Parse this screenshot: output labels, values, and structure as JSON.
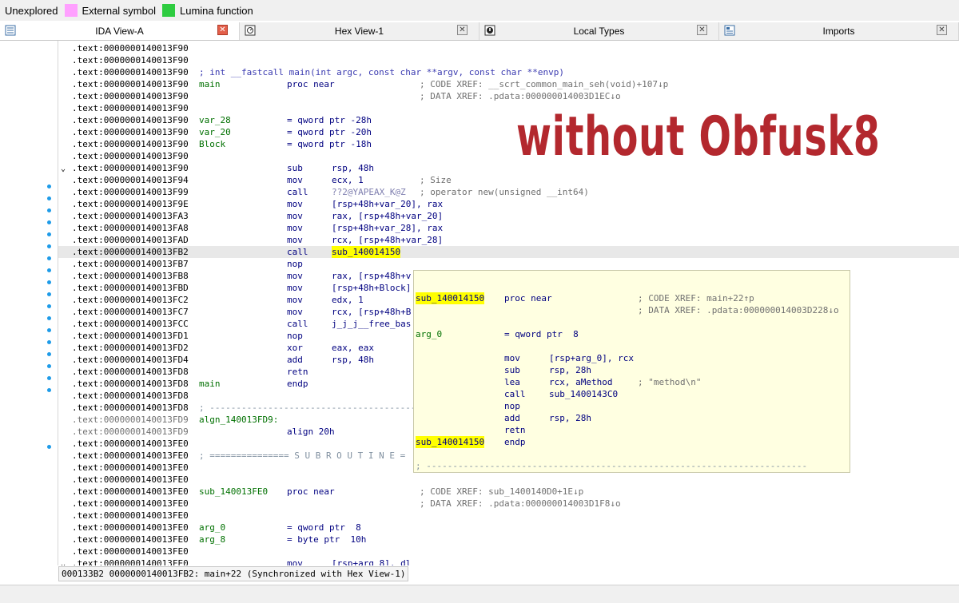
{
  "legend": {
    "items": [
      {
        "label": "Unexplored",
        "color": ""
      },
      {
        "label": "External symbol",
        "color": "#ffa0ff"
      },
      {
        "label": "Lumina function",
        "color": "#2ecc40"
      }
    ]
  },
  "tabs": [
    {
      "label": "IDA View-A",
      "icon": "ida-view-icon",
      "close": "✕"
    },
    {
      "label": "Hex View-1",
      "icon": "hex-view-icon",
      "close": "✕"
    },
    {
      "label": "Local Types",
      "icon": "local-types-icon",
      "close": "✕"
    },
    {
      "label": "Imports",
      "icon": "imports-icon",
      "close": "✕"
    }
  ],
  "watermark": "without Obfusk8",
  "lines": [
    {
      "a": ".text:0000000140013F90"
    },
    {
      "a": ".text:0000000140013F90"
    },
    {
      "a": ".text:0000000140013F90",
      "cm": "; int __fastcall main(int argc, const char **argv, const char **envp)"
    },
    {
      "a": ".text:0000000140013F90",
      "lbl": "main",
      "mn": "proc near",
      "xr": "; CODE XREF: __scrt_common_main_seh(void)+107↓p"
    },
    {
      "a": ".text:0000000140013F90",
      "xr": "; DATA XREF: .pdata:000000014003D1EC↓o"
    },
    {
      "a": ".text:0000000140013F90"
    },
    {
      "a": ".text:0000000140013F90",
      "lbl": "var_28",
      "mn": "= qword ptr -28h"
    },
    {
      "a": ".text:0000000140013F90",
      "lbl": "var_20",
      "mn": "= qword ptr -20h"
    },
    {
      "a": ".text:0000000140013F90",
      "lbl": "Block",
      "mn": "= qword ptr -18h"
    },
    {
      "a": ".text:0000000140013F90"
    },
    {
      "a": ".text:0000000140013F90",
      "mn": "sub",
      "op": "rsp, 48h",
      "chev": true
    },
    {
      "a": ".text:0000000140013F94",
      "mn": "mov",
      "op": "ecx, 1",
      "xr": "; Size"
    },
    {
      "a": ".text:0000000140013F99",
      "mn": "call",
      "sym": "??2@YAPEAX_K@Z",
      "xr": "; operator new(unsigned __int64)"
    },
    {
      "a": ".text:0000000140013F9E",
      "mn": "mov",
      "op": "[rsp+48h+var_20], rax"
    },
    {
      "a": ".text:0000000140013FA3",
      "mn": "mov",
      "op": "rax, [rsp+48h+var_20]"
    },
    {
      "a": ".text:0000000140013FA8",
      "mn": "mov",
      "op": "[rsp+48h+var_28], rax"
    },
    {
      "a": ".text:0000000140013FAD",
      "mn": "mov",
      "op": "rcx, [rsp+48h+var_28]"
    },
    {
      "a": ".text:0000000140013FB2",
      "mn": "call",
      "yel": "sub_140014150",
      "hl": true
    },
    {
      "a": ".text:0000000140013FB7",
      "mn": "nop"
    },
    {
      "a": ".text:0000000140013FB8",
      "mn": "mov",
      "op": "rax, [rsp+48h+v"
    },
    {
      "a": ".text:0000000140013FBD",
      "mn": "mov",
      "op": "[rsp+48h+Block]"
    },
    {
      "a": ".text:0000000140013FC2",
      "mn": "mov",
      "op": "edx, 1"
    },
    {
      "a": ".text:0000000140013FC7",
      "mn": "mov",
      "op": "rcx, [rsp+48h+B"
    },
    {
      "a": ".text:0000000140013FCC",
      "mn": "call",
      "op": "j_j_j__free_bas"
    },
    {
      "a": ".text:0000000140013FD1",
      "mn": "nop"
    },
    {
      "a": ".text:0000000140013FD2",
      "mn": "xor",
      "op": "eax, eax"
    },
    {
      "a": ".text:0000000140013FD4",
      "mn": "add",
      "op": "rsp, 48h"
    },
    {
      "a": ".text:0000000140013FD8",
      "mn": "retn"
    },
    {
      "a": ".text:0000000140013FD8",
      "lbl": "main",
      "mn": "endp"
    },
    {
      "a": ".text:0000000140013FD8"
    },
    {
      "a": ".text:0000000140013FD8",
      "sep": "; ---------------------------------------"
    },
    {
      "a": ".text:0000000140013FD9",
      "lbl": "algn_140013FD9:",
      "gray": true
    },
    {
      "a": ".text:0000000140013FD9",
      "mn": "align 20h",
      "gray": true
    },
    {
      "a": ".text:0000000140013FE0"
    },
    {
      "a": ".text:0000000140013FE0",
      "sep": "; =============== S U B R O U T I N E ="
    },
    {
      "a": ".text:0000000140013FE0"
    },
    {
      "a": ".text:0000000140013FE0"
    },
    {
      "a": ".text:0000000140013FE0",
      "lbl": "sub_140013FE0",
      "mn": "proc near",
      "xr": "; CODE XREF: sub_1400140D0+1E↓p"
    },
    {
      "a": ".text:0000000140013FE0",
      "xr": "; DATA XREF: .pdata:000000014003D1F8↓o"
    },
    {
      "a": ".text:0000000140013FE0"
    },
    {
      "a": ".text:0000000140013FE0",
      "lbl": "arg_0",
      "mn": "= qword ptr  8"
    },
    {
      "a": ".text:0000000140013FE0",
      "lbl": "arg_8",
      "mn": "= byte ptr  10h"
    },
    {
      "a": ".text:0000000140013FE0"
    },
    {
      "a": ".text:0000000140013FE0",
      "mn": "mov",
      "op": "[rsp+arg_8], dl",
      "chev": true
    }
  ],
  "popup": {
    "lines": [
      {
        "row": 2,
        "yel": "sub_140014150",
        "mn": "proc near",
        "xr": "; CODE XREF: main+22↑p"
      },
      {
        "row": 3,
        "xr": "; DATA XREF: .pdata:000000014003D228↓o"
      },
      {
        "row": 5,
        "lbl": "arg_0",
        "mn": "= qword ptr  8"
      },
      {
        "row": 7,
        "mn": "mov",
        "op": "[rsp+arg_0], rcx"
      },
      {
        "row": 8,
        "mn": "sub",
        "op": "rsp, 28h"
      },
      {
        "row": 9,
        "mn": "lea",
        "op": "rcx, aMethod",
        "xr": "; \"method\\n\""
      },
      {
        "row": 10,
        "mn": "call",
        "op": "sub_1400143C0"
      },
      {
        "row": 11,
        "mn": "nop"
      },
      {
        "row": 12,
        "mn": "add",
        "op": "rsp, 28h"
      },
      {
        "row": 13,
        "mn": "retn"
      },
      {
        "row": 14,
        "yel": "sub_140014150",
        "mn": "endp"
      },
      {
        "row": 16,
        "sep": "; ------------------------------------------------------------------------"
      }
    ]
  },
  "status": "000133B2 0000000140013FB2: main+22 (Synchronized with Hex View-1)"
}
